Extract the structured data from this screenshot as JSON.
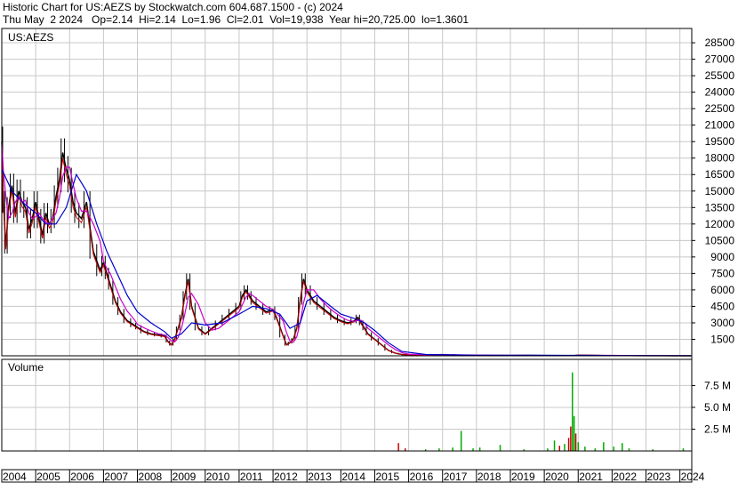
{
  "header": {
    "line1": "Historic Chart for US:AEZS by Stockwatch.com 604.687.1500 - (c) 2024",
    "line2": "Thu May  2 2024   Op=2.14  Hi=2.14  Lo=1.96  Cl=2.01  Vol=19,938  Year hi=20,725.00  lo=1.3601"
  },
  "colors": {
    "price": "#000000",
    "ma_short": "#cc0000",
    "ma_mid": "#cc00cc",
    "ma_long": "#0000cc",
    "vol_up": "#00aa00",
    "vol_down": "#cc0000",
    "grid": "#c8c8c8",
    "background": "#ffffff"
  },
  "chart_data": [
    {
      "type": "line",
      "label": "US:AEZS",
      "grid": true,
      "ylim": [
        0,
        29800
      ],
      "y_ticks": [
        1500,
        3000,
        4500,
        6000,
        7500,
        9000,
        10500,
        12000,
        13500,
        15000,
        16500,
        18000,
        19500,
        21000,
        22500,
        24000,
        25500,
        27000,
        28500
      ],
      "x_tick_labels": [
        "2004",
        "2005",
        "2006",
        "2007",
        "2008",
        "2009",
        "2010",
        "2011",
        "2012",
        "2013",
        "2014",
        "2015",
        "2016",
        "2017",
        "2018",
        "2019",
        "2020",
        "2021",
        "2022",
        "2023",
        "2024"
      ],
      "xlim": [
        2004.0,
        2024.35
      ],
      "series": [
        {
          "key": "price",
          "x": [
            2004.0,
            2004.05,
            2004.12,
            2004.2,
            2004.3,
            2004.4,
            2004.5,
            2004.6,
            2004.7,
            2004.8,
            2004.9,
            2005.0,
            2005.1,
            2005.2,
            2005.3,
            2005.4,
            2005.5,
            2005.6,
            2005.7,
            2005.8,
            2005.9,
            2006.0,
            2006.1,
            2006.2,
            2006.35,
            2006.5,
            2006.7,
            2006.9,
            2007.0,
            2007.1,
            2007.2,
            2007.35,
            2007.5,
            2007.7,
            2007.9,
            2008.0,
            2008.2,
            2008.4,
            2008.6,
            2008.8,
            2008.9,
            2009.0,
            2009.1,
            2009.2,
            2009.3,
            2009.4,
            2009.5,
            2009.6,
            2009.8,
            2010.0,
            2010.2,
            2010.4,
            2010.6,
            2010.8,
            2011.0,
            2011.1,
            2011.2,
            2011.3,
            2011.4,
            2011.6,
            2011.8,
            2012.0,
            2012.1,
            2012.3,
            2012.4,
            2012.5,
            2012.6,
            2012.7,
            2012.8,
            2012.9,
            2013.0,
            2013.2,
            2013.4,
            2013.6,
            2013.8,
            2014.0,
            2014.2,
            2014.4,
            2014.5,
            2014.6,
            2014.7,
            2014.8,
            2015.0,
            2015.2,
            2015.4,
            2015.6,
            2015.8,
            2016.0,
            2016.5,
            2017.0,
            2017.5,
            2018.0,
            2018.5,
            2019.0,
            2019.5,
            2020.0,
            2020.5,
            2020.9,
            2021.0,
            2021.5,
            2022.0,
            2022.5,
            2023.0,
            2023.5,
            2024.0,
            2024.33
          ],
          "values": [
            19500,
            14000,
            10000,
            13500,
            15500,
            13000,
            15000,
            14000,
            13500,
            11500,
            12500,
            14000,
            12500,
            11000,
            13000,
            12000,
            12500,
            14500,
            16000,
            18500,
            17000,
            16000,
            14000,
            13000,
            12500,
            14000,
            9500,
            7800,
            8500,
            7500,
            6500,
            5000,
            4000,
            3200,
            2800,
            2600,
            2200,
            2000,
            1900,
            1800,
            1300,
            1000,
            1500,
            2500,
            3500,
            5500,
            7000,
            4500,
            2500,
            2000,
            2500,
            3000,
            3500,
            4000,
            4500,
            5500,
            6000,
            5500,
            5000,
            4500,
            4000,
            4200,
            3500,
            1800,
            1000,
            1200,
            1500,
            2500,
            5000,
            7000,
            6000,
            5000,
            4500,
            4000,
            3500,
            3200,
            3000,
            3200,
            3500,
            3000,
            2500,
            2000,
            1500,
            1000,
            500,
            250,
            120,
            90,
            80,
            110,
            60,
            40,
            35,
            30,
            45,
            25,
            20,
            30,
            60,
            40,
            20,
            15,
            12,
            8,
            4,
            2
          ]
        },
        {
          "key": "ma_long",
          "x": [
            2004.0,
            2004.3,
            2004.6,
            2005.0,
            2005.3,
            2005.6,
            2005.9,
            2006.2,
            2006.5,
            2006.8,
            2007.1,
            2007.4,
            2007.7,
            2008.0,
            2008.4,
            2008.8,
            2009.0,
            2009.3,
            2009.6,
            2010.0,
            2010.5,
            2011.0,
            2011.4,
            2011.8,
            2012.2,
            2012.5,
            2012.8,
            2013.0,
            2013.3,
            2013.7,
            2014.0,
            2014.4,
            2014.7,
            2015.0,
            2015.4,
            2015.8,
            2016.5,
            2018.0,
            2020.0,
            2021.0,
            2022.0,
            2024.33
          ],
          "values": [
            17000,
            15000,
            14000,
            13000,
            12000,
            12000,
            13500,
            16500,
            15000,
            12000,
            9500,
            7500,
            5500,
            4000,
            3000,
            2200,
            1600,
            2000,
            3000,
            2800,
            3000,
            3800,
            4500,
            4300,
            3800,
            2500,
            3000,
            5000,
            5500,
            4500,
            3800,
            3400,
            3000,
            2300,
            1200,
            400,
            120,
            60,
            45,
            40,
            25,
            10
          ]
        }
      ]
    },
    {
      "type": "bar",
      "label": "Volume",
      "grid": true,
      "ylim": [
        0,
        10500000
      ],
      "y_tick_labels": [
        "2.5 M",
        "5.0 M",
        "7.5 M"
      ],
      "y_ticks": [
        2500000,
        5000000,
        7500000
      ],
      "bars": [
        {
          "x": 2015.7,
          "v": 900000,
          "dir": "down"
        },
        {
          "x": 2015.9,
          "v": 300000,
          "dir": "down"
        },
        {
          "x": 2016.5,
          "v": 200000,
          "dir": "up"
        },
        {
          "x": 2016.9,
          "v": 300000,
          "dir": "up"
        },
        {
          "x": 2017.3,
          "v": 400000,
          "dir": "up"
        },
        {
          "x": 2017.55,
          "v": 2300000,
          "dir": "up"
        },
        {
          "x": 2017.9,
          "v": 300000,
          "dir": "up"
        },
        {
          "x": 2018.1,
          "v": 400000,
          "dir": "up"
        },
        {
          "x": 2018.7,
          "v": 700000,
          "dir": "up"
        },
        {
          "x": 2019.4,
          "v": 200000,
          "dir": "up"
        },
        {
          "x": 2020.1,
          "v": 300000,
          "dir": "up"
        },
        {
          "x": 2020.3,
          "v": 1200000,
          "dir": "up"
        },
        {
          "x": 2020.45,
          "v": 600000,
          "dir": "down"
        },
        {
          "x": 2020.6,
          "v": 800000,
          "dir": "up"
        },
        {
          "x": 2020.72,
          "v": 1500000,
          "dir": "down"
        },
        {
          "x": 2020.78,
          "v": 2800000,
          "dir": "down"
        },
        {
          "x": 2020.83,
          "v": 9000000,
          "dir": "up"
        },
        {
          "x": 2020.88,
          "v": 4000000,
          "dir": "up"
        },
        {
          "x": 2020.93,
          "v": 2000000,
          "dir": "down"
        },
        {
          "x": 2021.0,
          "v": 1000000,
          "dir": "up"
        },
        {
          "x": 2021.2,
          "v": 500000,
          "dir": "up"
        },
        {
          "x": 2021.5,
          "v": 300000,
          "dir": "up"
        },
        {
          "x": 2021.75,
          "v": 1000000,
          "dir": "up"
        },
        {
          "x": 2022.05,
          "v": 500000,
          "dir": "up"
        },
        {
          "x": 2022.3,
          "v": 900000,
          "dir": "up"
        },
        {
          "x": 2022.5,
          "v": 300000,
          "dir": "up"
        },
        {
          "x": 2023.2,
          "v": 200000,
          "dir": "up"
        },
        {
          "x": 2024.1,
          "v": 300000,
          "dir": "up"
        }
      ]
    }
  ]
}
